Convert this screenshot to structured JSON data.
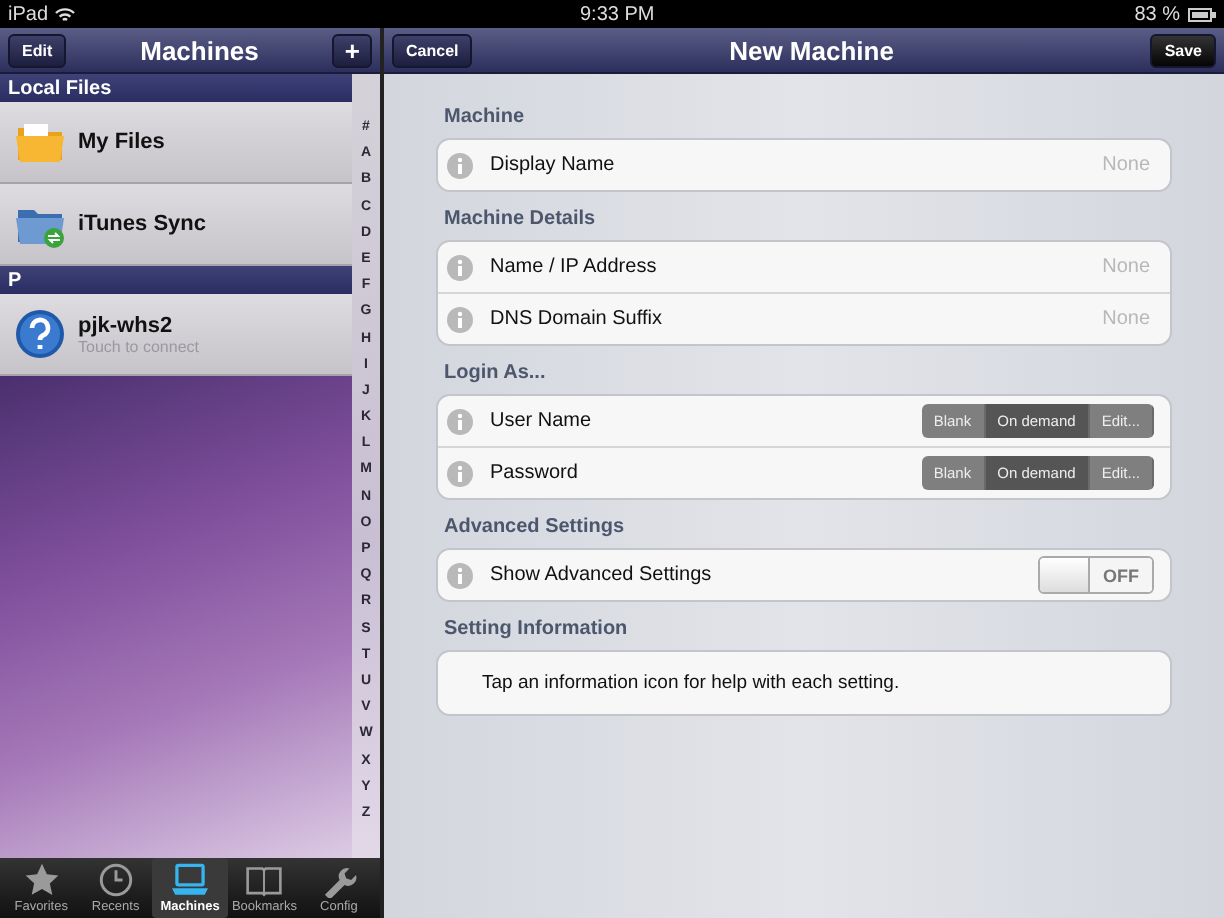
{
  "status_bar": {
    "carrier": "iPad",
    "time": "9:33 PM",
    "battery": "83 %"
  },
  "machines_panel": {
    "nav": {
      "edit_button": "Edit",
      "title": "Machines",
      "add_button": "+"
    },
    "sections": [
      {
        "header": "Local Files",
        "items": [
          {
            "kind": "folder",
            "title": "My Files"
          },
          {
            "kind": "sync",
            "title": "iTunes Sync"
          }
        ]
      },
      {
        "header": "P",
        "items": [
          {
            "kind": "unknown",
            "title": "pjk-whs2",
            "subtitle": "Touch to connect"
          }
        ]
      }
    ],
    "index": [
      "#",
      "A",
      "B",
      "C",
      "D",
      "E",
      "F",
      "G",
      "H",
      "I",
      "J",
      "K",
      "L",
      "M",
      "N",
      "O",
      "P",
      "Q",
      "R",
      "S",
      "T",
      "U",
      "V",
      "W",
      "X",
      "Y",
      "Z"
    ],
    "tabs": [
      {
        "kind": "star",
        "label": "Favorites",
        "selected": false
      },
      {
        "kind": "clock",
        "label": "Recents",
        "selected": false
      },
      {
        "kind": "laptop",
        "label": "Machines",
        "selected": true
      },
      {
        "kind": "book",
        "label": "Bookmarks",
        "selected": false
      },
      {
        "kind": "wrench",
        "label": "Config",
        "selected": false
      }
    ]
  },
  "detail_panel": {
    "nav": {
      "cancel_button": "Cancel",
      "title": "New Machine",
      "save_button": "Save"
    },
    "groups": [
      {
        "header": "Machine",
        "rows": [
          {
            "kind": "text",
            "label": "Display Name",
            "placeholder": "None"
          }
        ]
      },
      {
        "header": "Machine Details",
        "rows": [
          {
            "kind": "text",
            "label": "Name / IP Address",
            "placeholder": "None"
          },
          {
            "kind": "text",
            "label": "DNS Domain Suffix",
            "placeholder": "None"
          }
        ]
      },
      {
        "header": "Login As...",
        "rows": [
          {
            "kind": "segmented",
            "label": "User Name",
            "options": [
              {
                "label": "Blank",
                "selected": false
              },
              {
                "label": "On demand",
                "selected": true
              },
              {
                "label": "Edit...",
                "selected": false
              }
            ]
          },
          {
            "kind": "segmented",
            "label": "Password",
            "options": [
              {
                "label": "Blank",
                "selected": false
              },
              {
                "label": "On demand",
                "selected": true
              },
              {
                "label": "Edit...",
                "selected": false
              }
            ]
          }
        ]
      },
      {
        "header": "Advanced Settings",
        "rows": [
          {
            "kind": "switch",
            "label": "Show Advanced Settings",
            "on": false,
            "state_label": "OFF"
          }
        ]
      },
      {
        "header": "Setting Information",
        "note": "Tap an information icon for help with each setting."
      }
    ]
  }
}
